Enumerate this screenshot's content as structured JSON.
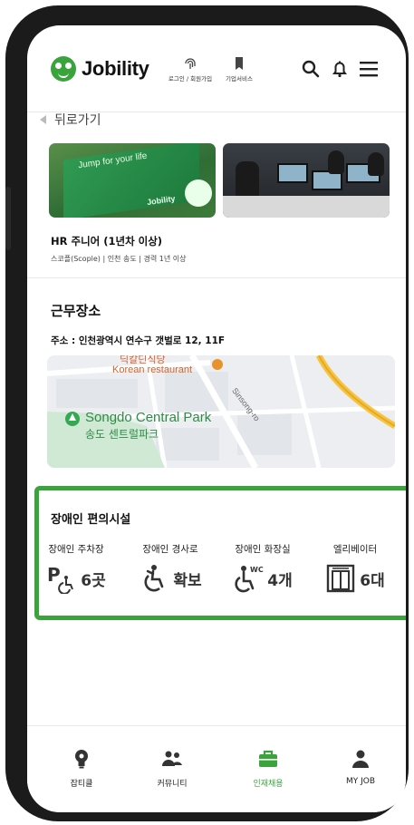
{
  "brand": {
    "name": "Jobility"
  },
  "header": {
    "links": [
      {
        "label": "로그인 / 회원가입"
      },
      {
        "label": "기업서비스"
      }
    ]
  },
  "back": {
    "label": "뒤로가기"
  },
  "images": {
    "banner_text": "Jump for your life",
    "banner_brand": "Jobility"
  },
  "job": {
    "title": "HR 주니어 (1년차 이상)",
    "meta": "스코플(Scople)  |  인천 송도  |  경력 1년 이상"
  },
  "workplace": {
    "title": "근무장소",
    "address": "주소 : 인천광역시 연수구 갯벌로 12, 11F",
    "map": {
      "poi_top_ko": "딕칼딘식당",
      "poi_top_en": "Korean restaurant",
      "road": "Sinsong-ro",
      "park_en": "Songdo Central Park",
      "park_ko": "송도 센트럴파크"
    }
  },
  "facilities": {
    "title": "장애인 편의시설",
    "items": [
      {
        "label": "장애인 주차장",
        "value": "6곳",
        "icon": "parking-accessible-icon"
      },
      {
        "label": "장애인 경사로",
        "value": "확보",
        "icon": "ramp-accessible-icon"
      },
      {
        "label": "장애인 화장실",
        "value": "4개",
        "icon": "wc-accessible-icon"
      },
      {
        "label": "엘리베이터",
        "value": "6대",
        "icon": "elevator-icon"
      }
    ]
  },
  "nav": {
    "items": [
      {
        "label": "잡티클"
      },
      {
        "label": "커뮤니티"
      },
      {
        "label": "인재채용"
      },
      {
        "label": "MY JOB"
      }
    ],
    "active_index": 2
  },
  "colors": {
    "accent": "#3aa33c",
    "text": "#111111",
    "muted": "#444444"
  }
}
